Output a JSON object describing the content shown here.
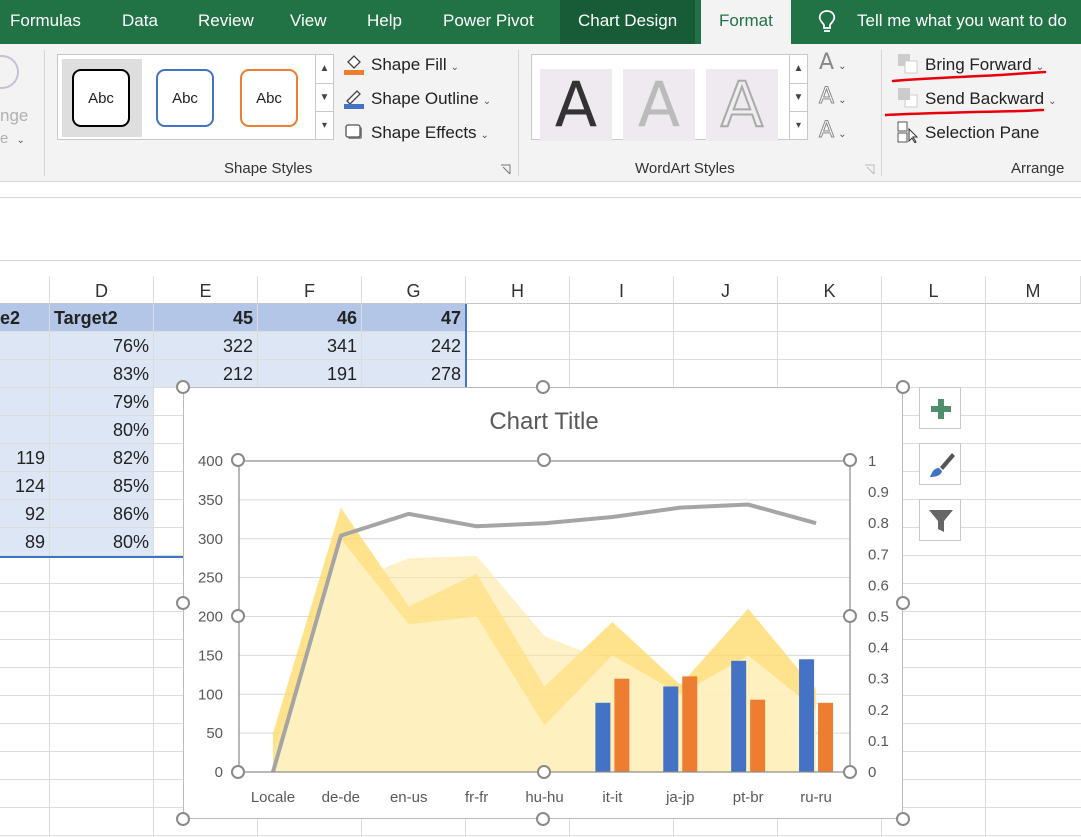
{
  "ribbon_tabs": [
    {
      "label": "Formulas"
    },
    {
      "label": "Data"
    },
    {
      "label": "Review"
    },
    {
      "label": "View"
    },
    {
      "label": "Help"
    },
    {
      "label": "Power Pivot"
    },
    {
      "label": "Chart Design"
    },
    {
      "label": "Format"
    }
  ],
  "tell_me": "Tell me what you want to do",
  "left_group": {
    "partial_label_1": "nge",
    "partial_label_2": "e"
  },
  "shape_styles": {
    "samples": [
      "Abc",
      "Abc",
      "Abc"
    ],
    "shape_fill": "Shape Fill",
    "shape_outline": "Shape Outline",
    "shape_effects": "Shape Effects",
    "group_label": "Shape Styles"
  },
  "wordart_styles": {
    "samples": [
      "A",
      "A",
      "A"
    ],
    "mini": [
      "A",
      "A",
      "A"
    ],
    "group_label": "WordArt Styles"
  },
  "arrange": {
    "bring_forward": "Bring Forward",
    "send_backward": "Send Backward",
    "selection_pane": "Selection Pane",
    "group_label": "Arrange"
  },
  "columns": [
    "D",
    "E",
    "F",
    "G",
    "H",
    "I",
    "J",
    "K",
    "L",
    "M"
  ],
  "table": {
    "header": [
      "e2",
      "Target2",
      "45",
      "46",
      "47"
    ],
    "rows": [
      [
        "",
        "76%",
        "322",
        "341",
        "242"
      ],
      [
        "",
        "83%",
        "212",
        "191",
        "278"
      ],
      [
        "",
        "79%",
        "",
        "",
        ""
      ],
      [
        "",
        "80%",
        "",
        "",
        ""
      ],
      [
        "119",
        "82%",
        "",
        "",
        ""
      ],
      [
        "124",
        "85%",
        "",
        "",
        ""
      ],
      [
        "92",
        "86%",
        "",
        "",
        ""
      ],
      [
        "89",
        "80%",
        "",
        "",
        ""
      ]
    ]
  },
  "colors": {
    "excel_green": "#217346",
    "bar_blue": "#4472c4",
    "bar_orange": "#ed7d31",
    "line_gray": "#a5a5a5",
    "area_yellow": "#ffd966",
    "annotation_red": "#e8000b"
  },
  "chart_data": {
    "type": "bar",
    "title": "Chart Title",
    "categories": [
      "Locale",
      "de-de",
      "en-us",
      "fr-fr",
      "hu-hu",
      "it-it",
      "ja-jp",
      "pt-br",
      "ru-ru"
    ],
    "y_left_ticks": [
      "0",
      "50",
      "100",
      "150",
      "200",
      "250",
      "300",
      "350",
      "400"
    ],
    "y_right_ticks": [
      "0",
      "0.1",
      "0.2",
      "0.3",
      "0.4",
      "0.5",
      "0.6",
      "0.7",
      "0.8",
      "0.9",
      "1"
    ],
    "ylim": [
      0,
      400
    ],
    "ylim_right": [
      0,
      1
    ],
    "series": [
      {
        "kind": "bar",
        "color": "#4472c4",
        "values": [
          null,
          null,
          null,
          null,
          null,
          89,
          110,
          143,
          145
        ]
      },
      {
        "kind": "bar",
        "color": "#ed7d31",
        "values": [
          null,
          null,
          null,
          null,
          null,
          120,
          123,
          93,
          89
        ]
      },
      {
        "kind": "line",
        "axis": "right",
        "color": "#a5a5a5",
        "values": [
          0,
          0.76,
          0.83,
          0.79,
          0.8,
          0.82,
          0.85,
          0.86,
          0.8
        ]
      },
      {
        "kind": "area",
        "color": "#ffd966",
        "opacity": 0.75,
        "values": [
          50,
          340,
          213,
          255,
          110,
          193,
          112,
          210,
          105
        ]
      },
      {
        "kind": "area",
        "color": "#ffe699",
        "opacity": 0.55,
        "values": [
          30,
          240,
          275,
          278,
          175,
          140,
          90,
          60,
          110
        ]
      },
      {
        "kind": "area",
        "color": "#fff2cc",
        "opacity": 0.8,
        "values": [
          0,
          300,
          190,
          200,
          60,
          150,
          100,
          150,
          80
        ]
      }
    ],
    "grid": true
  }
}
